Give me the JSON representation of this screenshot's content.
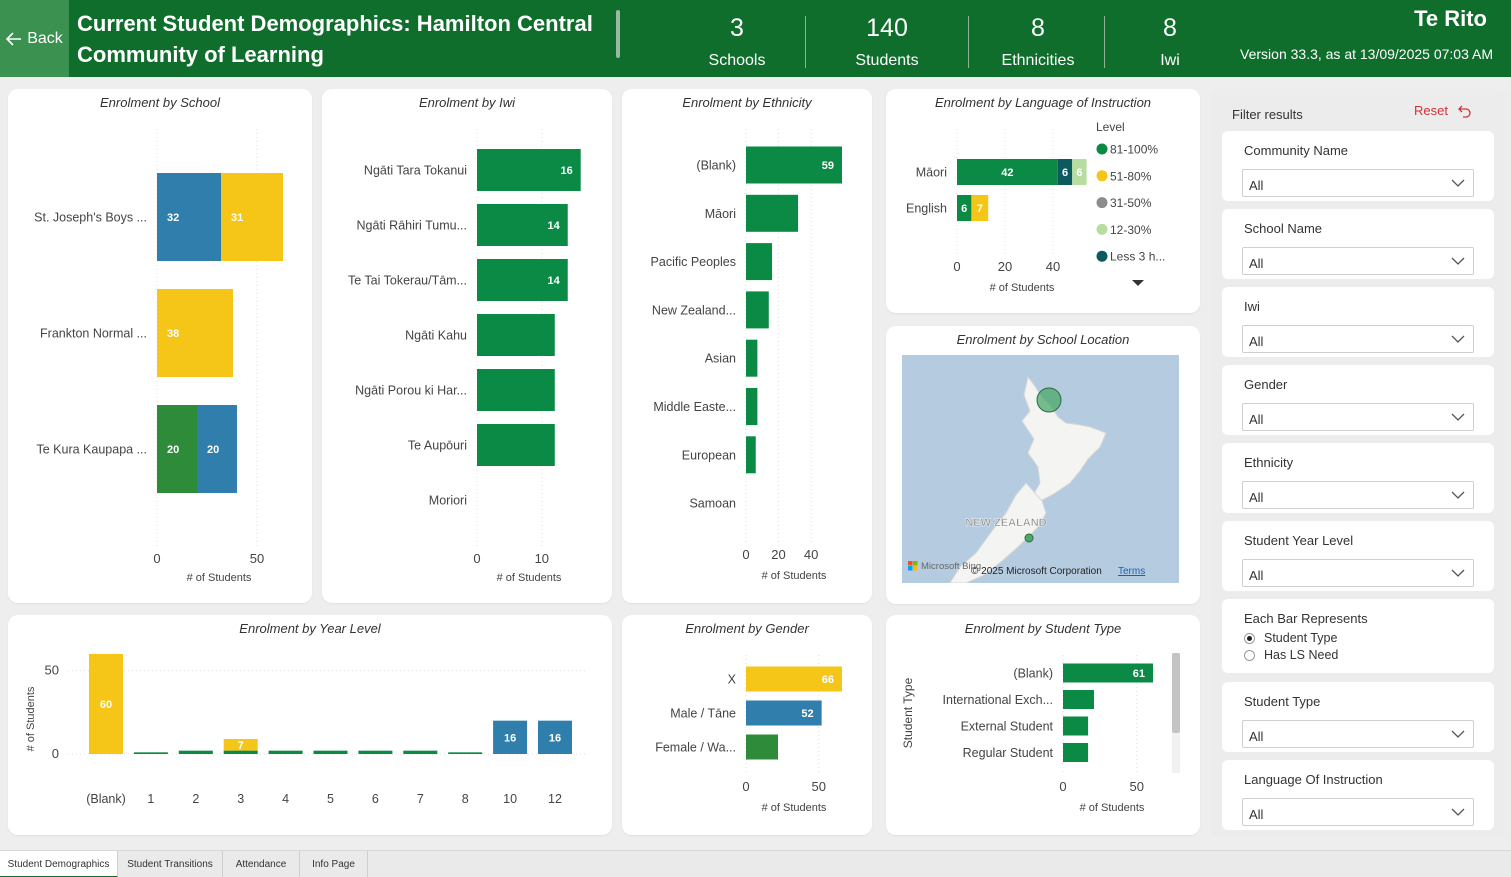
{
  "header": {
    "back_label": "Back",
    "title": "Current Student Demographics: Hamilton Central Community of Learning",
    "kpis": [
      {
        "value": "3",
        "label": "Schools"
      },
      {
        "value": "140",
        "label": "Students"
      },
      {
        "value": "8",
        "label": "Ethnicities"
      },
      {
        "value": "8",
        "label": "Iwi"
      }
    ],
    "brand": "Te Rito",
    "version": "Version 33.3, as at 13/09/2025 07:03 AM"
  },
  "colors": {
    "header_green": "#0f6e2c",
    "green_81_100": "#0a8a45",
    "yellow_51_80": "#f5c518",
    "blue": "#2f7eab",
    "dark_green": "#2e8b3a",
    "teal_less3": "#0c5a5e",
    "light_green_12_30": "#b8dda1",
    "grey_31_50": "#8c8c8c"
  },
  "cards": {
    "by_school": "Enrolment by School",
    "by_iwi": "Enrolment by Iwi",
    "by_ethnicity": "Enrolment by Ethnicity",
    "by_language": "Enrolment by Language of Instruction",
    "by_location": "Enrolment by School Location",
    "by_year": "Enrolment by Year Level",
    "by_gender": "Enrolment by Gender",
    "by_type": "Enrolment by Student Type"
  },
  "map": {
    "country_label": "NEW ZEALAND",
    "provider": "Microsoft Bing",
    "copyright": "© 2025 Microsoft Corporation",
    "terms": "Terms"
  },
  "filters": {
    "title": "Filter results",
    "reset": "Reset",
    "community_name": {
      "label": "Community Name",
      "value": "All"
    },
    "school_name": {
      "label": "School Name",
      "value": "All"
    },
    "iwi": {
      "label": "Iwi",
      "value": "All"
    },
    "gender": {
      "label": "Gender",
      "value": "All"
    },
    "ethnicity": {
      "label": "Ethnicity",
      "value": "All"
    },
    "year_level": {
      "label": "Student Year Level",
      "value": "All"
    },
    "bar_represents": {
      "label": "Each Bar Represents",
      "options": [
        "Student Type",
        "Has LS Need"
      ],
      "selected": "Student Type"
    },
    "student_type": {
      "label": "Student Type",
      "value": "All"
    },
    "language": {
      "label": "Language Of Instruction",
      "value": "All"
    }
  },
  "tabs": [
    "Student Demographics",
    "Student Transitions",
    "Attendance",
    "Info Page"
  ],
  "active_tab": "Student Demographics",
  "chart_data": [
    {
      "type": "bar",
      "orientation": "horizontal",
      "stacked": true,
      "title": "Enrolment by School",
      "xlabel": "# of Students",
      "xlim": [
        0,
        60
      ],
      "xticks": [
        0,
        50
      ],
      "categories": [
        "St. Joseph's Boys ...",
        "Frankton Normal ...",
        "Te Kura Kaupapa ..."
      ],
      "segments": [
        [
          {
            "value": 32,
            "label": "32",
            "color": "#2f7eab"
          },
          {
            "value": 31,
            "label": "31",
            "color": "#f5c518"
          }
        ],
        [
          {
            "value": 38,
            "label": "38",
            "color": "#f5c518"
          }
        ],
        [
          {
            "value": 20,
            "label": "20",
            "color": "#2e8b3a"
          },
          {
            "value": 20,
            "label": "20",
            "color": "#2f7eab"
          }
        ]
      ]
    },
    {
      "type": "bar",
      "orientation": "horizontal",
      "title": "Enrolment by Iwi",
      "xlabel": "# of Students",
      "xlim": [
        0,
        16.2
      ],
      "xticks": [
        0,
        10
      ],
      "categories": [
        "Ngāti Tara Tokanui",
        "Ngāti Rāhiri Tumu...",
        "Te Tai Tokerau/Tām...",
        "Ngāti Kahu",
        "Ngāti Porou ki Har...",
        "Te Aupōuri",
        "Moriori"
      ],
      "values": [
        16,
        14,
        14,
        12,
        12,
        12,
        0
      ],
      "labels": [
        "16",
        "14",
        "14",
        "",
        "",
        "",
        ""
      ]
    },
    {
      "type": "bar",
      "orientation": "horizontal",
      "title": "Enrolment by Ethnicity",
      "xlabel": "# of Students",
      "xlim": [
        0,
        59
      ],
      "xticks": [
        0,
        20,
        40
      ],
      "categories": [
        "(Blank)",
        "Māori",
        "Pacific Peoples",
        "New Zealand...",
        "Asian",
        "Middle Easte...",
        "European",
        "Samoan"
      ],
      "values": [
        59,
        32,
        16,
        14,
        7,
        7,
        6,
        0
      ],
      "labels": [
        "59",
        "",
        "",
        "",
        "",
        "",
        "",
        ""
      ]
    },
    {
      "type": "bar",
      "orientation": "horizontal",
      "stacked": true,
      "title": "Enrolment by Language of Instruction",
      "xlabel": "# of Students",
      "xlim": [
        0,
        50
      ],
      "xticks": [
        0,
        20,
        40
      ],
      "categories": [
        "Māori",
        "English"
      ],
      "legend_title": "Level",
      "legend": [
        {
          "name": "81-100%",
          "color": "#0a8a45"
        },
        {
          "name": "51-80%",
          "color": "#f5c518"
        },
        {
          "name": "31-50%",
          "color": "#8c8c8c"
        },
        {
          "name": "12-30%",
          "color": "#b8dda1"
        },
        {
          "name": "Less 3 h...",
          "color": "#0c5a5e"
        }
      ],
      "segments": [
        [
          {
            "value": 42,
            "label": "42",
            "color": "#0a8a45"
          },
          {
            "value": 6,
            "label": "6",
            "color": "#0c5a5e"
          },
          {
            "value": 6,
            "label": "6",
            "color": "#b8dda1"
          }
        ],
        [
          {
            "value": 6,
            "label": "6",
            "color": "#0a8a45"
          },
          {
            "value": 7,
            "label": "7",
            "color": "#f5c518"
          }
        ]
      ]
    },
    {
      "type": "bar",
      "orientation": "vertical",
      "title": "Enrolment by Year Level",
      "ylabel": "# of Students",
      "ylim": [
        0,
        60
      ],
      "yticks": [
        0,
        50
      ],
      "categories": [
        "(Blank)",
        "1",
        "2",
        "3",
        "4",
        "5",
        "6",
        "7",
        "8",
        "10",
        "12"
      ],
      "values": [
        60,
        1,
        2,
        9,
        2,
        2,
        2,
        2,
        1,
        20,
        20
      ],
      "labels": [
        "60",
        "",
        "",
        "7",
        "",
        "",
        "",
        "",
        "",
        "16",
        "16"
      ]
    },
    {
      "type": "bar",
      "orientation": "horizontal",
      "title": "Enrolment by Gender",
      "xlabel": "# of Students",
      "xlim": [
        0,
        66
      ],
      "xticks": [
        0,
        50
      ],
      "categories": [
        "X",
        "Male / Tāne",
        "Female / Wa..."
      ],
      "values": [
        66,
        52,
        22
      ],
      "labels": [
        "66",
        "52",
        ""
      ]
    },
    {
      "type": "bar",
      "orientation": "horizontal",
      "title": "Enrolment by Student Type",
      "xlabel": "# of Students",
      "ylabel": "Student Type",
      "xlim": [
        0,
        61
      ],
      "xticks": [
        0,
        50
      ],
      "categories": [
        "(Blank)",
        "International Exch...",
        "External Student",
        "Regular Student"
      ],
      "values": [
        61,
        21,
        17,
        17
      ],
      "labels": [
        "61",
        "",
        "",
        ""
      ]
    }
  ]
}
